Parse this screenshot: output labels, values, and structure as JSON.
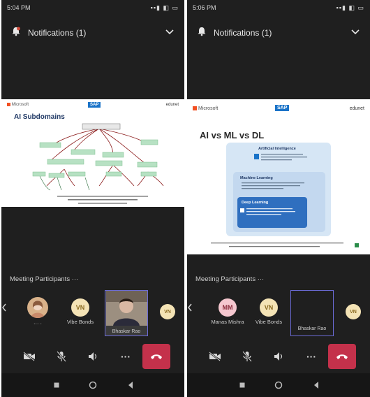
{
  "left": {
    "status": {
      "time": "5:04 PM",
      "sysicons": "▪▪▮ ◧ ▭"
    },
    "notifications": {
      "label": "Notifications (1)"
    },
    "slide": {
      "brand_left": "Microsoft",
      "brand_center": "SAP",
      "brand_right": "edunet",
      "title": "AI Subdomains"
    },
    "participants_label": "Meeting Participants ···",
    "participants": [
      {
        "initials": "VN",
        "name": "Vibe Bonds"
      },
      {
        "initials": "",
        "name": "Bhaskar Rao"
      }
    ],
    "controls": {
      "camera": "camera-off-icon",
      "mic": "mic-off-icon",
      "speaker": "speaker-icon",
      "more": "···",
      "end": "end-call-icon"
    }
  },
  "right": {
    "status": {
      "time": "5:06 PM",
      "sysicons": "▪▪▮ ◧ ▭"
    },
    "notifications": {
      "label": "Notifications (1)"
    },
    "slide": {
      "brand_left": "Microsoft",
      "brand_center": "SAP",
      "brand_right": "edunet",
      "title": "AI vs ML vs DL",
      "box1_title": "Artificial Intelligence",
      "box2_title": "Machine Learning",
      "box3_title": "Deep Learning"
    },
    "participants_label": "Meeting Participants ···",
    "participants": [
      {
        "initials": "MM",
        "name": "Manas Mishra"
      },
      {
        "initials": "VN",
        "name": "Vibe Bonds"
      },
      {
        "initials": "",
        "name": "Bhaskar Rao"
      },
      {
        "initials": "VN",
        "name": ""
      }
    ]
  },
  "colors": {
    "bg": "#1f1f1f",
    "end_call": "#c4314b",
    "avatar_vn": "#f4e3b5",
    "avatar_mm": "#f5c7cf",
    "active_border": "#6b6bd6"
  }
}
